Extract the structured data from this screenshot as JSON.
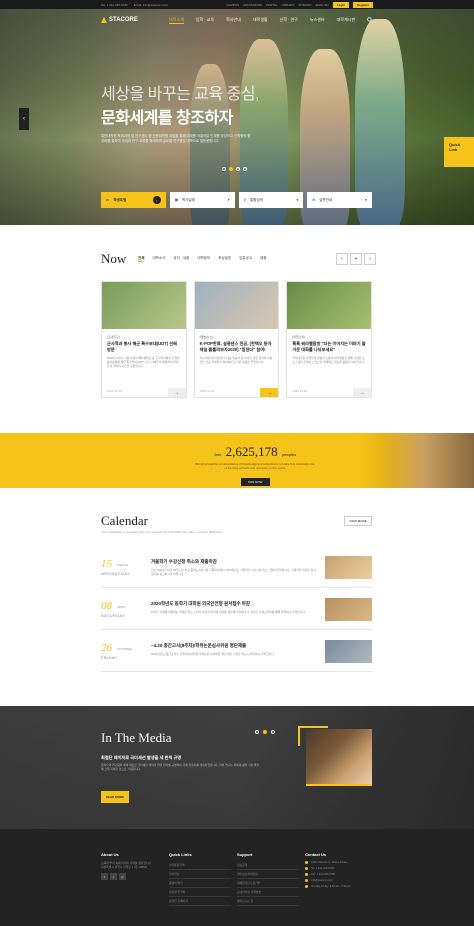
{
  "topbar": {
    "tel": "Tel. 1 012-345-6789",
    "email": "Email. info@stacore.co.kr",
    "links": [
      "CAMPUS",
      "ADMISSIONS",
      "PORTAL",
      "LIBRARY",
      "SITEMAP",
      "ENGLISH"
    ],
    "login": "Login",
    "register": "Register"
  },
  "nav": {
    "logo": "STACORE",
    "items": [
      "대학소개",
      "입학 · 교육",
      "학사안내",
      "대학생활",
      "산학 · 연구",
      "뉴스센터",
      "대학게시판"
    ],
    "active_index": 0
  },
  "hero": {
    "line1": "세상을 바꾸는 교육 중심,",
    "line2_strong": "문화세계",
    "line2_rest": "를 창조하자",
    "desc": "일반대학원 학위과정 및 연구센터 중 전문대학원 과정을 통해 미래를 이끌어갈 인재를 양성하고 산학협력 활성화를 통하여 국내외 연구 교류를 확대하며 글로벌 연구중심 대학으로 발돋움합니다.",
    "quick_link": "Quick Link",
    "search": [
      {
        "label": "학생포털",
        "icon": "monitor-icon"
      },
      {
        "label": "학사일정",
        "icon": "calendar-icon"
      },
      {
        "label": "통합검색",
        "icon": "search-icon"
      },
      {
        "label": "입학안내",
        "icon": "chat-icon"
      }
    ]
  },
  "now": {
    "title": "Now",
    "tabs": [
      "전체",
      "대학소식",
      "공지 · 새움",
      "대학정보",
      "포상발표",
      "입찰공고",
      "채용"
    ],
    "cards": [
      {
        "tag": "[교내주요]",
        "title": "군사학과 봉사 해군 특수부대(UDT) 선배 방문",
        "body": "2020년 2학기 서울과 해사 해사캠퍼스 중 군사학과에서 진행된 봉사활동에 해군 특수부대(UDT) 출신 선배들이 방문하여 학생들과 대화의 시간을 가졌습니다.",
        "date": "2020.11.05",
        "colors": [
          "#7a9a5a",
          "#b8c88a"
        ]
      },
      {
        "tag": "[앨범/뉴스]",
        "title": "K-POP한류, 실용댄스 전공, [한택오 동아제일 물흘려보자2020] \"힘찼다\" 참여!",
        "body": "지난 9월 4일 대한민국 대표 방송사 중 하나인 관련 행사에 실용댄스 전공 학생들이 참여하여 뜨거운 호응을 얻었습니다.",
        "date": "2020.11.05",
        "colors": [
          "#a0b0c0",
          "#d8c8b0"
        ]
      },
      {
        "tag": "[대학소식]",
        "title": "톡톡 워라밸탐방 \"더는 이어지는 이야기 즐거운 대화를 나눠보세요\"",
        "body": "우리대학은 학생들의 원활한 소통과 대학생활을 위해 다양한 프로그램을 운영하고 있으며 올해에도 새로운 활동을 이어갑니다.",
        "date": "2020.11.05",
        "colors": [
          "#6a8a4a",
          "#a8c070"
        ]
      }
    ]
  },
  "join": {
    "prefix": "Join",
    "number": "2,625,178",
    "suffix": "peoples",
    "desc": "Bringing together an abundance of knowledge and experience to make this university one of the best schools and university in the world.",
    "button": "JOIN NOW"
  },
  "calendar": {
    "title": "Calendar",
    "subtitle": "Your satisfaction in knowing that your research at STACORE will make a positive difference.",
    "view_more": "VIEW MORE",
    "events": [
      {
        "day": "15",
        "month": "MARCH",
        "weekday": "WEDNESDAY",
        "title": "겨울학기 수강신청 취소와 재출마감",
        "body": "지난 2020년 12월 18일 (금) 본교 중앙도서관 1층 다목적실에서 2020학년도 겨울학기 수강신청 취소 신청이 진행됩니다. 구체적인 일정은 학사공지를 참고하시기 바랍니다.",
        "colors": [
          "#c8a070",
          "#e8d0a0"
        ]
      },
      {
        "day": "08",
        "month": "APRIL",
        "weekday": "SATURDAY",
        "title": "2020학년도 동학기 대학원 외국인전형 원서접수 마감",
        "body": "외국인 전형에 지원하는 학생은 반드시 원서 마감일 이전에 서류를 제출해야 하며 추가 서류는 국제교류처를 통해 문의하시기 바랍니다.",
        "colors": [
          "#b89060",
          "#d8b888"
        ]
      },
      {
        "day": "26",
        "month": "OCTOBER",
        "weekday": "FRIDAY",
        "title": "~4.20 중간고사(8주차)/학위논문심사위원 명단제출",
        "body": "2020학년도 중간고사가 진행되며 대학원 학위논문 심사위원 명단 제출 기한을 반드시 확인하시기 바랍니다.",
        "colors": [
          "#7a8a9a",
          "#b0b8c0"
        ]
      }
    ]
  },
  "media": {
    "title": "In The Media",
    "headline": "최첨단 레이저로 극미세선 발생을 세 번씩 규명",
    "body": "물리학과 연구팀이 세계 최초로 극미세선 레이저 발생 원리를 규명하여 국제 학술지에 게재되었습니다. 이번 연구는 차세대 광학 기술 발전에 크게 기여할 것으로 기대됩니다.",
    "button": "READ MORE"
  },
  "footer": {
    "about_title": "About Us",
    "about_text": "교육의 뿌리 속에 내리며 미래를 생각합니다.",
    "address_line": "서울특별시 관악구 관악로 1 (우) 08826",
    "quick_title": "Quick Links",
    "quick": [
      "대학통합검색",
      "학사일정",
      "증명서 발급",
      "대학원 입학처",
      "온라인 홈페이지"
    ],
    "support_title": "Support",
    "support": [
      "정보공개",
      "개인정보처리방침",
      "이메일무단수집거부",
      "교내인터넷 전화번호",
      "찾아오시는 길"
    ],
    "contact_title": "Contact Us",
    "contact": [
      "1234, Stacore-ro, Seoul, Korea",
      "Tel. 1 012-345-6789",
      "Fax. 1 012-345-6789",
      "info@stacore.co.kr",
      "Monday-Friday: 9:00 am - 5:30 pm"
    ]
  },
  "colors": {
    "accent": "#f6c31a",
    "dark": "#232323"
  }
}
